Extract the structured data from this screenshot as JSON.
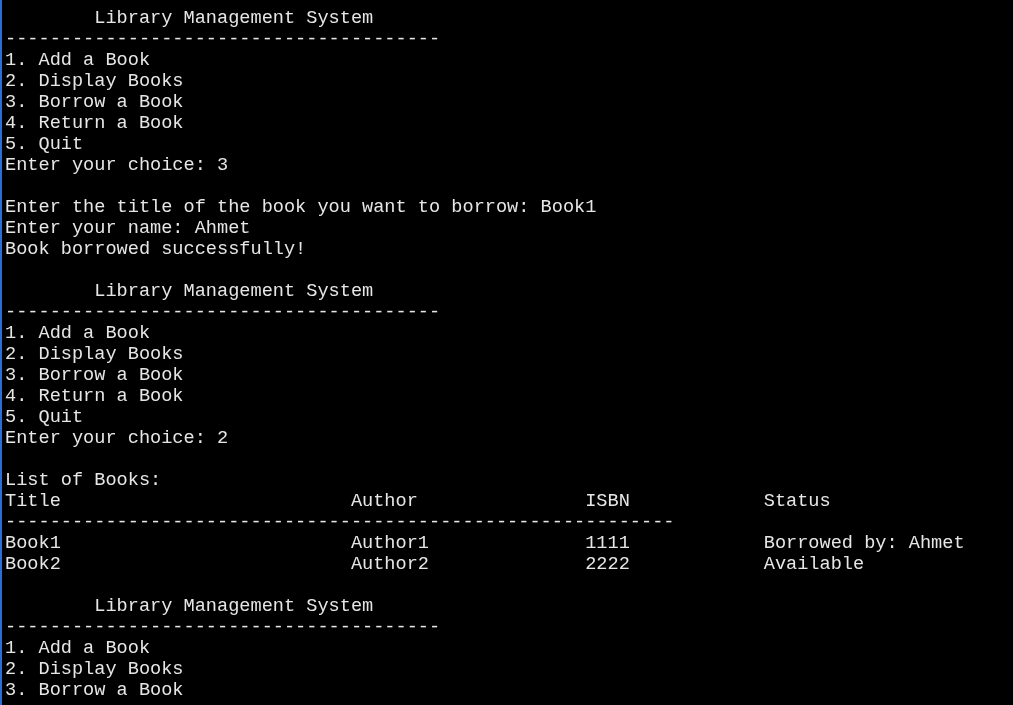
{
  "console_lines": [
    {
      "kind": "heading",
      "text": "        Library Management System"
    },
    {
      "kind": "rule",
      "text": "---------------------------------------"
    },
    {
      "kind": "menu",
      "text": "1. Add a Book"
    },
    {
      "kind": "menu",
      "text": "2. Display Books"
    },
    {
      "kind": "menu",
      "text": "3. Borrow a Book"
    },
    {
      "kind": "menu",
      "text": "4. Return a Book"
    },
    {
      "kind": "menu",
      "text": "5. Quit"
    },
    {
      "kind": "prompt",
      "text": "Enter your choice: 3"
    },
    {
      "kind": "blank"
    },
    {
      "kind": "prompt",
      "text": "Enter the title of the book you want to borrow: Book1"
    },
    {
      "kind": "prompt",
      "text": "Enter your name: Ahmet"
    },
    {
      "kind": "message",
      "text": "Book borrowed successfully!"
    },
    {
      "kind": "blank"
    },
    {
      "kind": "heading",
      "text": "        Library Management System"
    },
    {
      "kind": "rule",
      "text": "---------------------------------------"
    },
    {
      "kind": "menu",
      "text": "1. Add a Book"
    },
    {
      "kind": "menu",
      "text": "2. Display Books"
    },
    {
      "kind": "menu",
      "text": "3. Borrow a Book"
    },
    {
      "kind": "menu",
      "text": "4. Return a Book"
    },
    {
      "kind": "menu",
      "text": "5. Quit"
    },
    {
      "kind": "prompt",
      "text": "Enter your choice: 2"
    },
    {
      "kind": "blank"
    },
    {
      "kind": "message",
      "text": "List of Books:"
    },
    {
      "kind": "table",
      "columns": [
        "Title",
        "Author",
        "ISBN",
        "Status"
      ],
      "rule": "------------------------------------------------------------",
      "rows": [
        [
          "Book1",
          "Author1",
          "1111",
          "Borrowed by: Ahmet"
        ],
        [
          "Book2",
          "Author2",
          "2222",
          "Available"
        ]
      ]
    },
    {
      "kind": "blank"
    },
    {
      "kind": "heading",
      "text": "        Library Management System"
    },
    {
      "kind": "rule",
      "text": "---------------------------------------"
    },
    {
      "kind": "menu",
      "text": "1. Add a Book"
    },
    {
      "kind": "menu",
      "text": "2. Display Books"
    },
    {
      "kind": "menu",
      "text": "3. Borrow a Book"
    }
  ]
}
